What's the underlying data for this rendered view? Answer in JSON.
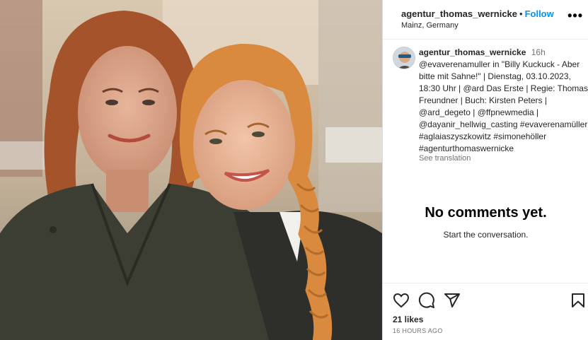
{
  "post": {
    "username": "agentur_thomas_wernicke",
    "follow_label": "Follow",
    "location": "Mainz, Germany",
    "more_label": "•••"
  },
  "caption": {
    "username": "agentur_thomas_wernicke",
    "time": "16h",
    "text": "@evaverenamuller in \"Billy Kuckuck - Aber bitte mit Sahne!\" | Dienstag, 03.10.2023, 18:30 Uhr | @ard Das Erste | Regie: Thomas Freundner | Buch: Kirsten Peters | @ard_degeto | @ffpnewmedia | @dayanir_hellwig_casting #evaverenamüller #aglaiaszyszkowitz #simonehöller #agenturthomaswernicke",
    "see_translation": "See translation"
  },
  "comments": {
    "empty_title": "No comments yet.",
    "empty_subtitle": "Start the conversation."
  },
  "actions": {
    "likes": "21 likes",
    "time_ago": "16 HOURS AGO",
    "icons": [
      "heart-icon",
      "comment-icon",
      "share-icon",
      "bookmark-icon"
    ]
  },
  "colors": {
    "link": "#0095f6",
    "muted": "#737373",
    "text": "#262626"
  }
}
